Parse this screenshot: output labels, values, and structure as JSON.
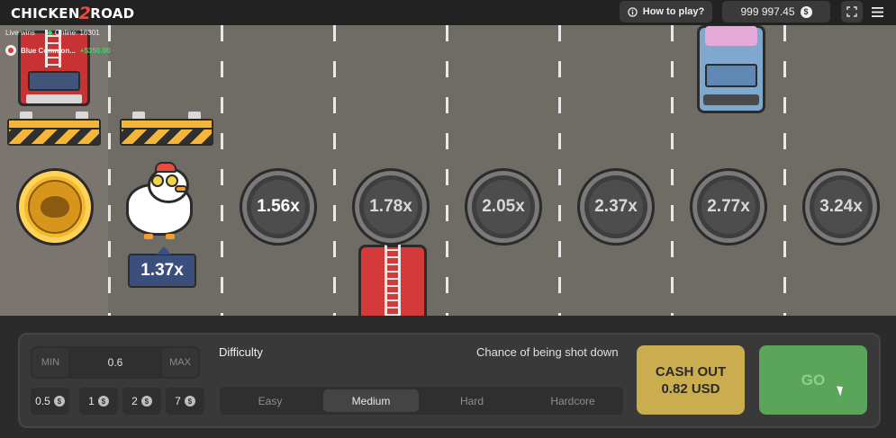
{
  "header": {
    "logo_left": "CHICKEN",
    "logo_mid": "2",
    "logo_right": "ROAD",
    "how_to_play": "How to play?",
    "balance": "999 997.45",
    "currency_symbol": "$"
  },
  "live": {
    "label": "Live wins",
    "online": "Online: 16301",
    "win_name": "Blue Common...",
    "win_amount": "+$350.00"
  },
  "game": {
    "current_multiplier": "1.37x",
    "multipliers": [
      "1.56x",
      "1.78x",
      "2.05x",
      "2.37x",
      "2.77x",
      "3.24x"
    ]
  },
  "controls": {
    "min_label": "MIN",
    "max_label": "MAX",
    "bet_value": "0.6",
    "quick_bets": [
      "0.5",
      "1",
      "2",
      "7"
    ],
    "difficulty_label": "Difficulty",
    "chance_label": "Chance of being shot down",
    "difficulties": [
      "Easy",
      "Medium",
      "Hard",
      "Hardcore"
    ],
    "selected_difficulty": "Medium",
    "cashout_line1": "CASH OUT",
    "cashout_line2": "0.82 USD",
    "go_label": "GO"
  },
  "colors": {
    "road": "#6f6b65",
    "lane_line": "#e9e9e9",
    "cashout": "#c9ad4e",
    "go": "#5aa55a",
    "multiplier_badge": "#3b4f7c",
    "online_dot": "#3fd46b"
  }
}
